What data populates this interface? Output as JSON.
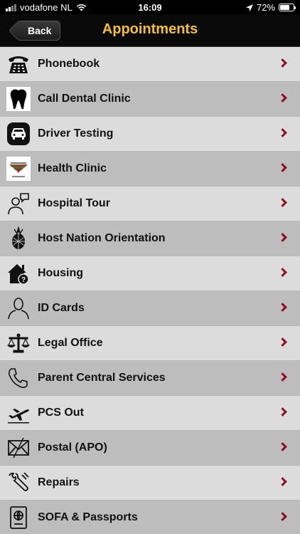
{
  "status_bar": {
    "carrier": "vodafone NL",
    "time": "16:09",
    "battery": "72%",
    "battery_level": 0.72
  },
  "nav": {
    "back_label": "Back",
    "title": "Appointments"
  },
  "colors": {
    "title": "#f5c02c",
    "chevron": "#8b1020",
    "row_light": "#dcdcdc",
    "row_dark": "#bdbdbd"
  },
  "items": [
    {
      "label": "Phonebook",
      "icon": "telephone-icon"
    },
    {
      "label": "Call Dental Clinic",
      "icon": "tooth-icon"
    },
    {
      "label": "Driver Testing",
      "icon": "car-icon"
    },
    {
      "label": "Health Clinic",
      "icon": "health-clinic-logo"
    },
    {
      "label": "Hospital Tour",
      "icon": "person-speech-icon"
    },
    {
      "label": "Host Nation Orientation",
      "icon": "pineapple-icon"
    },
    {
      "label": "Housing",
      "icon": "house-question-icon"
    },
    {
      "label": "ID Cards",
      "icon": "person-outline-icon"
    },
    {
      "label": "Legal Office",
      "icon": "scales-icon"
    },
    {
      "label": "Parent Central Services",
      "icon": "phone-handset-icon"
    },
    {
      "label": "PCS Out",
      "icon": "airplane-icon"
    },
    {
      "label": "Postal (APO)",
      "icon": "envelope-icon"
    },
    {
      "label": "Repairs",
      "icon": "wrench-icon"
    },
    {
      "label": "SOFA & Passports",
      "icon": "passport-icon"
    }
  ]
}
